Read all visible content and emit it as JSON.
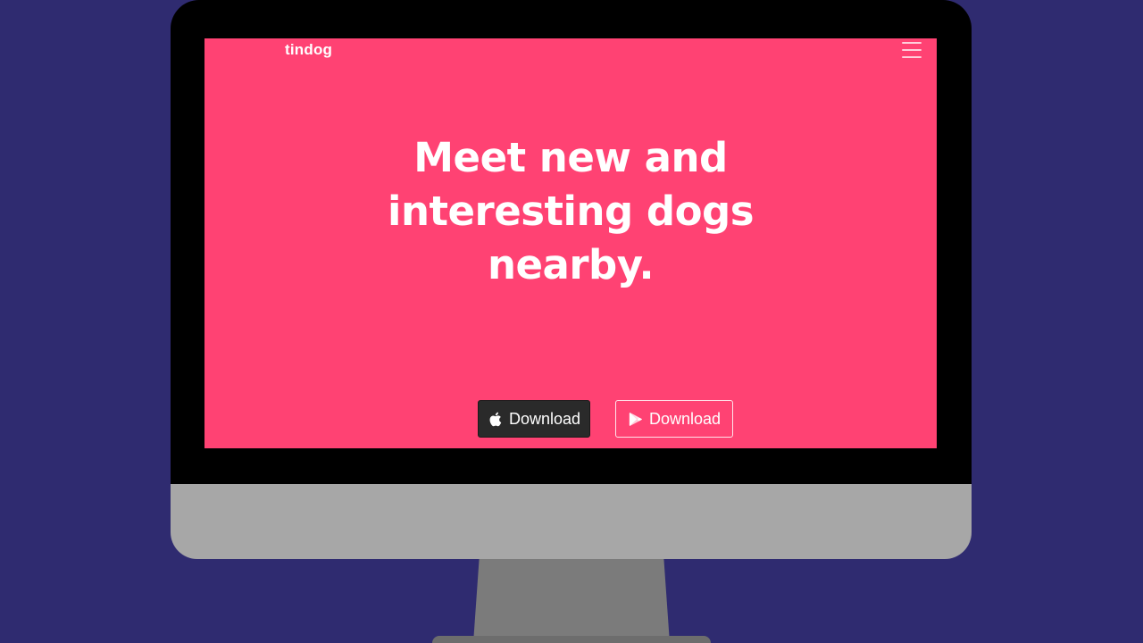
{
  "navbar": {
    "brand": "tindog",
    "menu_icon": "hamburger-menu-icon"
  },
  "hero": {
    "headline_lines": [
      "Meet new and",
      "interesting dogs",
      "nearby."
    ]
  },
  "buttons": {
    "apple": {
      "label": "Download",
      "icon": "apple-icon"
    },
    "google": {
      "label": "Download",
      "icon": "google-play-icon"
    }
  },
  "colors": {
    "background": "#2f2b70",
    "screen": "#ff4273",
    "apple_button": "#2a2a2a",
    "bezel": "#000000",
    "chin": "#a7a7a7",
    "stand": "#7b7b7b"
  }
}
